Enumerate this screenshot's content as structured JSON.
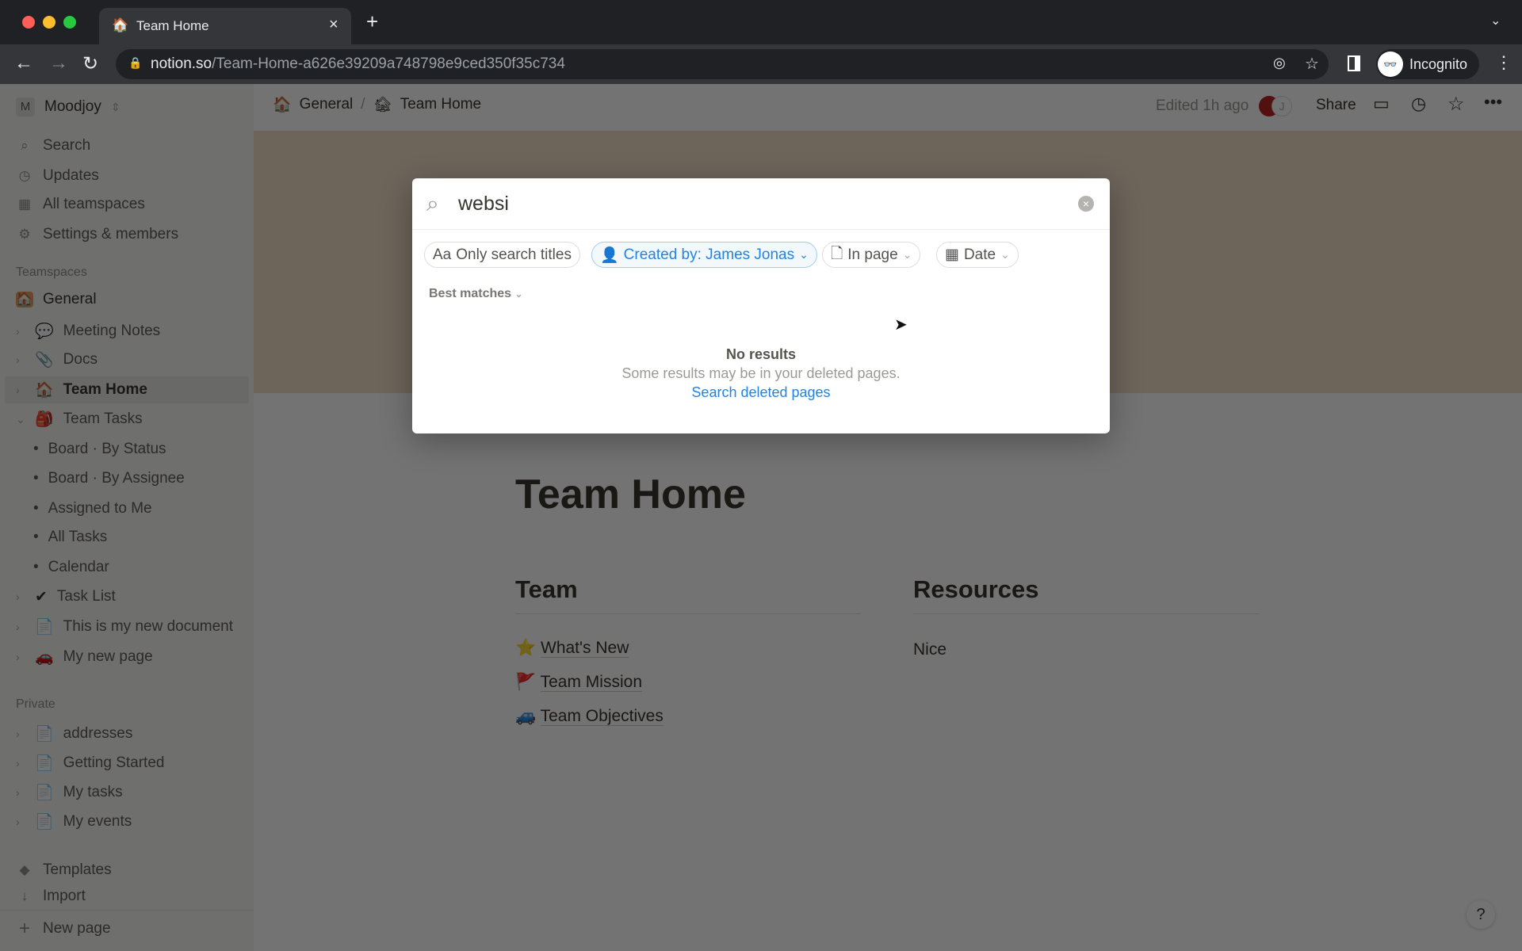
{
  "browser": {
    "tab_title": "Team Home",
    "url_domain": "notion.so",
    "url_path": "/Team-Home-a626e39209a748798e9ced350f35c734",
    "profile_label": "Incognito"
  },
  "header": {
    "breadcrumb": [
      {
        "icon": "🏠",
        "label": "General"
      },
      {
        "icon": "🏚",
        "label": "Team Home"
      }
    ],
    "edited": "Edited 1h ago",
    "avatar_initial": "J",
    "share": "Share"
  },
  "sidebar": {
    "workspace_initial": "M",
    "workspace": "Moodjoy",
    "top_items": [
      {
        "icon": "search-icon",
        "label": "Search"
      },
      {
        "icon": "clock-icon",
        "label": "Updates"
      },
      {
        "icon": "grid-icon",
        "label": "All teamspaces"
      },
      {
        "icon": "gear-icon",
        "label": "Settings & members"
      }
    ],
    "teamspaces_label": "Teamspaces",
    "general": "General",
    "team_items": [
      {
        "icon": "💬",
        "label": "Meeting Notes"
      },
      {
        "icon": "📎",
        "label": "Docs"
      },
      {
        "icon": "🏠",
        "label": "Team Home"
      },
      {
        "icon": "🎒",
        "label": "Team Tasks"
      }
    ],
    "sub_items": [
      "Board · By Status",
      "Board · By Assignee",
      "Assigned to Me",
      "All Tasks",
      "Calendar"
    ],
    "more_items": [
      {
        "icon": "✔",
        "label": "Task List"
      },
      {
        "icon": "📄",
        "label": "This is my new document"
      },
      {
        "icon": "🚗",
        "label": "My new page"
      }
    ],
    "private_label": "Private",
    "private_items": [
      "addresses",
      "Getting Started",
      "My tasks",
      "My events"
    ],
    "templates": "Templates",
    "import": "Import",
    "new_page": "New page"
  },
  "page": {
    "title": "Team Home",
    "team_heading": "Team",
    "resources_heading": "Resources",
    "team_links": [
      {
        "icon": "⭐",
        "label": "What's New"
      },
      {
        "icon": "🚩",
        "label": "Team Mission"
      },
      {
        "icon": "🚙",
        "label": "Team Objectives"
      }
    ],
    "resources_text": "Nice",
    "help": "?"
  },
  "search": {
    "query": "websi",
    "filters": {
      "titles": "Only search titles",
      "titles_prefix": "Aa",
      "created_by": "Created by: James Jonas",
      "in_page": "In page",
      "date": "Date"
    },
    "sort": "Best matches",
    "no_results": "No results",
    "hint": "Some results may be in your deleted pages.",
    "deleted_link": "Search deleted pages"
  },
  "colors": {
    "accent": "#2383e2"
  }
}
